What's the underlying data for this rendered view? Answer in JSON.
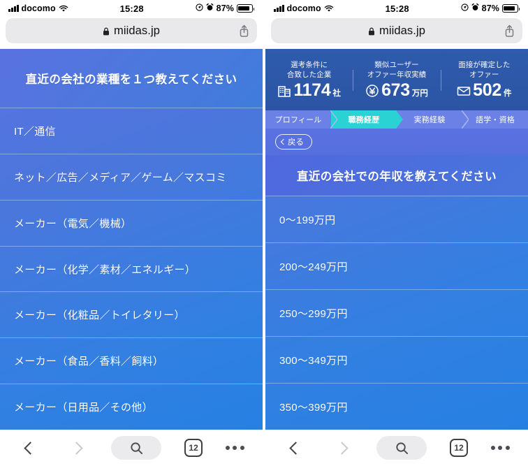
{
  "statusbar": {
    "carrier": "docomo",
    "time": "15:28",
    "battery_pct": "87%",
    "signal_icon": "signal-bars-icon",
    "wifi_icon": "wifi-icon",
    "location_icon": "location-arrow-icon",
    "alarm_icon": "alarm-clock-icon",
    "battery_icon": "battery-icon"
  },
  "browser": {
    "url": "miidas.jp",
    "lock_icon": "lock-icon",
    "share_icon": "share-icon"
  },
  "toolbar": {
    "back_icon": "chevron-left-icon",
    "forward_icon": "chevron-right-icon",
    "search_icon": "search-icon",
    "tabs_count": "12",
    "more_icon": "ellipsis-icon"
  },
  "left_page": {
    "question": "直近の会社の業種を１つ教えてください",
    "options": [
      "IT／通信",
      "ネット／広告／メディア／ゲーム／マスコミ",
      "メーカー（電気／機械）",
      "メーカー（化学／素材／エネルギー）",
      "メーカー（化粧品／トイレタリー）",
      "メーカー（食品／香料／飼料）",
      "メーカー（日用品／その他）"
    ]
  },
  "right_page": {
    "stats": [
      {
        "caption_line1": "選考条件に",
        "caption_line2": "合致した企業",
        "icon": "building-icon",
        "number": "1174",
        "unit": "社"
      },
      {
        "caption_line1": "類似ユーザー",
        "caption_line2": "オファー年収実績",
        "icon": "yen-circle-icon",
        "number": "673",
        "unit": "万円"
      },
      {
        "caption_line1": "面接が確定した",
        "caption_line2": "オファー",
        "icon": "envelope-icon",
        "number": "502",
        "unit": "件"
      }
    ],
    "steps": [
      {
        "label": "プロフィール",
        "active": false
      },
      {
        "label": "職務経歴",
        "active": true
      },
      {
        "label": "実務経験",
        "active": false
      },
      {
        "label": "語学・資格",
        "active": false
      }
    ],
    "back_button": "戻る",
    "question": "直近の会社での年収を教えてください",
    "options": [
      "0〜199万円",
      "200〜249万円",
      "250〜299万円",
      "300〜349万円",
      "350〜399万円"
    ]
  },
  "colors": {
    "gradient_start": "#5a72e0",
    "gradient_end": "#2680e3",
    "stats_bar": "#2f5bad",
    "active_step": "#2ad2d4",
    "step_inactive": "#6b81e6",
    "toolbar_bg": "#ffffff"
  }
}
